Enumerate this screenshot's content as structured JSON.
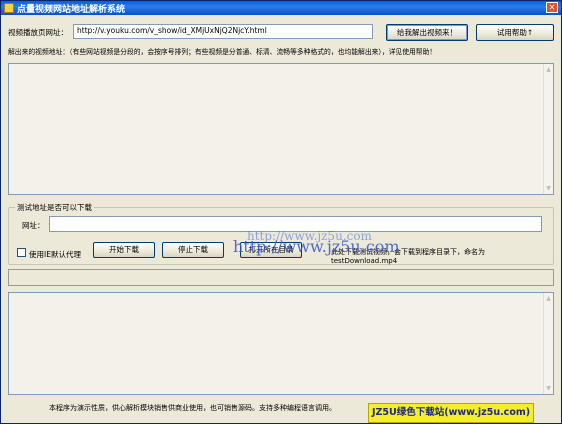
{
  "window": {
    "title": "点量视频网站地址解析系统",
    "close_glyph": "✕"
  },
  "top": {
    "url_label": "视频播放页网址：",
    "url_value": "http://v.youku.com/v_show/id_XMjUxNjQ2NjcY.html",
    "parse_button": "给我解出视频来！",
    "help_button": "试用帮助↑"
  },
  "result": {
    "label": "解出来的视频地址：（有些网站视频是分段的，会按序号排列；有些视频是分普通、标清、流畅等多种格式的，也均能解出来），详见使用帮助！"
  },
  "download_test": {
    "group_title": "测试地址是否可以下载",
    "url_label": "网址：",
    "url_value": "",
    "checkbox_label": "使用IE默认代理",
    "start_button": "开始下载",
    "stop_button": "停止下载",
    "open_button": "打开所在目录",
    "info_line1": "此处下载测试视频，会下载到程序目录下，命名为",
    "info_line2": "testDownload.mp4"
  },
  "footer": {
    "text": "本程序为演示性质，供心解析模块销售供商业使用，也可销售源码。支持多种编程语言调用。"
  },
  "watermark": {
    "small": "http://www.jz5u.com",
    "large": "http://www.jz5u.com"
  },
  "badge": {
    "text": "JZ5U绿色下载站(www.jz5u.com)"
  },
  "colors": {
    "title_bar": "#0a5fd8",
    "badge_bg": "#f5ee2a",
    "badge_text": "#1a2a8a"
  }
}
